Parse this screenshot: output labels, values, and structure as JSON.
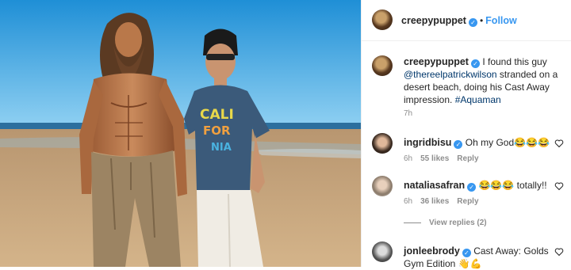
{
  "post": {
    "username": "creepypuppet",
    "follow_label": "Follow",
    "separator": "•",
    "caption_mention": "@thereelpatrickwilson",
    "caption_text": " stranded on a desert beach, doing his Cast Away impression. ",
    "caption_lead": "I found this guy ",
    "caption_hashtag": "#Aquaman",
    "time": "7h",
    "photo_shirt_text": "CALI FOR NIA"
  },
  "comments": [
    {
      "username": "ingridbisu",
      "text": "Oh my God😂😂😂",
      "time": "6h",
      "likes": "55 likes",
      "reply": "Reply"
    },
    {
      "username": "nataliasafran",
      "text": "😂😂😂 totally!!",
      "time": "6h",
      "likes": "36 likes",
      "reply": "Reply"
    },
    {
      "username": "jonleebrody",
      "text": "Cast Away: Golds Gym Edition 👋💪",
      "time": "",
      "likes": "",
      "reply": ""
    }
  ],
  "view_replies": "View replies (2)",
  "colors": {
    "accent": "#3897f0",
    "link": "#00376b",
    "muted": "#8e8e8e"
  }
}
